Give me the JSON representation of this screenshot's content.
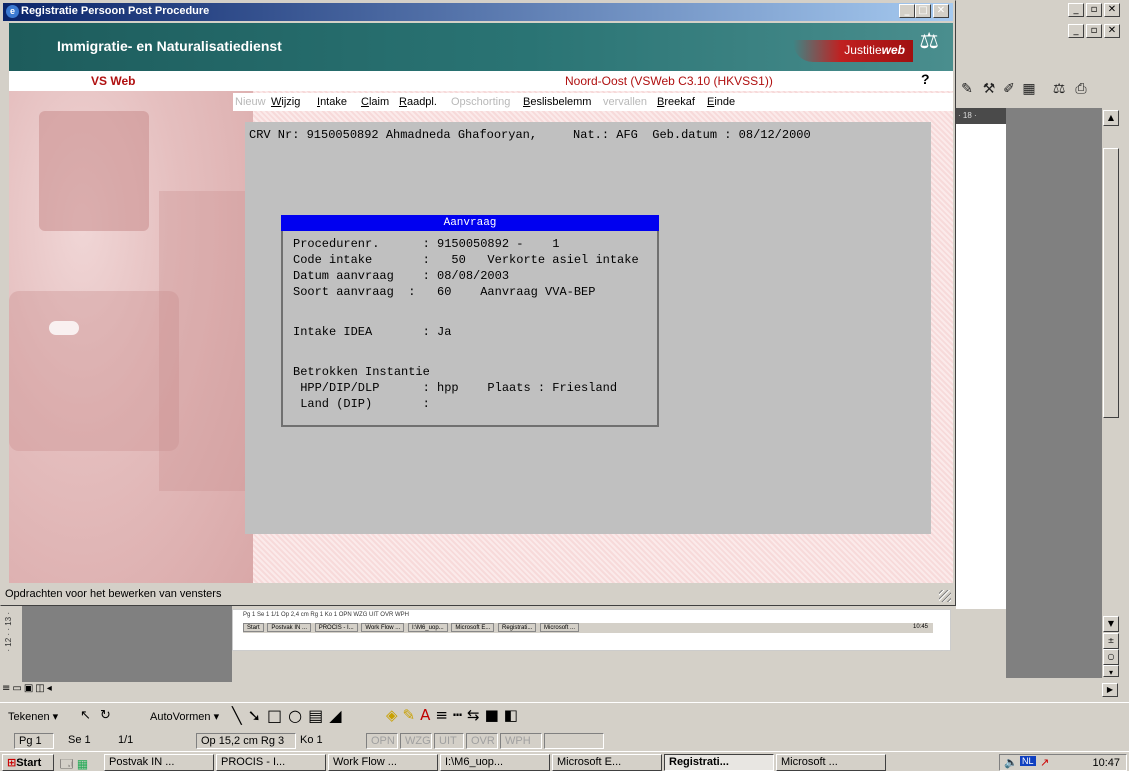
{
  "main_window": {
    "title": "Registratie Persoon Post Procedure",
    "status_text": "Opdrachten voor het bewerken van vensters"
  },
  "header": {
    "org_name": "Immigratie- en Naturalisatiedienst",
    "logo_prefix": "Justitie",
    "logo_suffix": "web"
  },
  "app": {
    "name": "VS Web",
    "server": "Noord-Oost  (VSWeb C3.10 (HKVSS1))",
    "help": "?"
  },
  "menu": [
    {
      "label": "Nieuw",
      "enabled": false
    },
    {
      "label": "Wijzig",
      "enabled": true
    },
    {
      "label": "Intake",
      "enabled": true
    },
    {
      "label": "Claim",
      "enabled": true
    },
    {
      "label": "Raadpl.",
      "enabled": true
    },
    {
      "label": "Opschorting",
      "enabled": false
    },
    {
      "label": "Beslisbelemm",
      "enabled": true
    },
    {
      "label": "vervallen",
      "enabled": false
    },
    {
      "label": "Breekaf",
      "enabled": true
    },
    {
      "label": "Einde",
      "enabled": true
    }
  ],
  "terminal": {
    "crv_line": "CRV Nr: 9150050892 Ahmadneda Ghafooryan,     Nat.: AFG  Geb.datum : 08/12/2000",
    "dialog": {
      "title": "Aanvraag",
      "lines": [
        "Procedurenr.      : 9150050892 -    1",
        "Code intake       :   50   Verkorte asiel intake",
        "Datum aanvraag    : 08/08/2003",
        "Soort aanvraag  :   60    Aanvraag VVA-BEP",
        "",
        "",
        "Intake IDEA       : Ja",
        "",
        "",
        "Betrokken Instantie",
        " HPP/DIP/DLP      : hpp    Plaats : Friesland",
        " Land (DIP)       :"
      ]
    }
  },
  "word": {
    "ruler_text": "· 18 ·",
    "left_ruler": "· 12 · · 13 ·",
    "drawing_toolbar": {
      "tekenen": "Tekenen ▾",
      "autovormen": "AutoVormen ▾"
    },
    "status": [
      {
        "text": "Pg 1",
        "dim": false
      },
      {
        "text": "Se 1",
        "dim": false
      },
      {
        "text": "1/1",
        "dim": false
      },
      {
        "text": "Op 15,2 cm  Rg 3",
        "dim": false
      },
      {
        "text": "Ko 1",
        "dim": false
      },
      {
        "text": "OPN",
        "dim": true
      },
      {
        "text": "WZG",
        "dim": true
      },
      {
        "text": "UIT",
        "dim": true
      },
      {
        "text": "OVR",
        "dim": true
      },
      {
        "text": "WPH",
        "dim": true
      }
    ],
    "mini_status": "Pg 1    Se 1      1/1    Op 2,4 cm  Rg 1    Ko 1      OPN  WZG  UIT  OVR  WPH",
    "mini_task": [
      "Start",
      "Postvak IN ...",
      "PROCIS - I...",
      "Work Flow ...",
      "I:\\M6_uop...",
      "Microsoft E...",
      "Registrati...",
      "Microsoft ..."
    ],
    "mini_clock": "10:45"
  },
  "taskbar": {
    "start": "Start",
    "buttons": [
      {
        "label": "Postvak IN ...",
        "active": false
      },
      {
        "label": "PROCIS - I...",
        "active": false
      },
      {
        "label": "Work Flow ...",
        "active": false
      },
      {
        "label": "I:\\M6_uop...",
        "active": false
      },
      {
        "label": "Microsoft E...",
        "active": false
      },
      {
        "label": "Registrati...",
        "active": true
      },
      {
        "label": "Microsoft ...",
        "active": false
      }
    ],
    "tray_lang": "NL",
    "clock": "10:47"
  }
}
